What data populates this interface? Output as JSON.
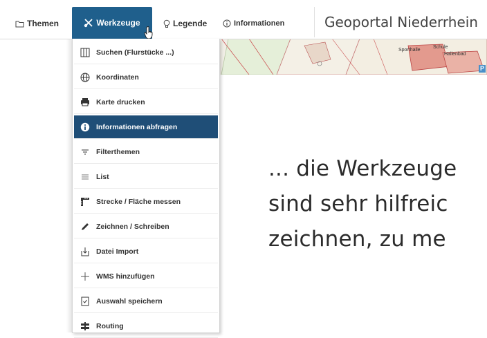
{
  "nav": {
    "themen": "Themen",
    "werkzeuge": "Werkzeuge",
    "legende": "Legende",
    "informationen": "Informationen"
  },
  "title": "Geoportal Niederrhein",
  "map_labels": {
    "sporthalle": "Sporthalle",
    "schule": "Schule",
    "hallenbad": "Hallenbad",
    "p": "P"
  },
  "menu": [
    {
      "label": "Suchen (Flurstücke ...)",
      "icon": "grid-icon"
    },
    {
      "label": "Koordinaten",
      "icon": "globe-icon"
    },
    {
      "label": "Karte drucken",
      "icon": "printer-icon"
    },
    {
      "label": "Informationen abfragen",
      "icon": "info-icon",
      "active": true
    },
    {
      "label": "Filterthemen",
      "icon": "filter-icon"
    },
    {
      "label": "List",
      "icon": "list-icon"
    },
    {
      "label": "Strecke / Fläche messen",
      "icon": "ruler-icon"
    },
    {
      "label": "Zeichnen / Schreiben",
      "icon": "pencil-icon"
    },
    {
      "label": "Datei Import",
      "icon": "file-import-icon"
    },
    {
      "label": "WMS hinzufügen",
      "icon": "plus-icon"
    },
    {
      "label": "Auswahl speichern",
      "icon": "save-selection-icon"
    },
    {
      "label": "Routing",
      "icon": "signpost-icon"
    }
  ],
  "caption": {
    "line1": "... die Werkzeuge",
    "line2": "sind sehr hilfreic",
    "line3": "zeichnen, zu me"
  },
  "colors": {
    "accent": "#1f5f8c",
    "active_item": "#1f4e77",
    "map_bg": "#f1eee6"
  }
}
